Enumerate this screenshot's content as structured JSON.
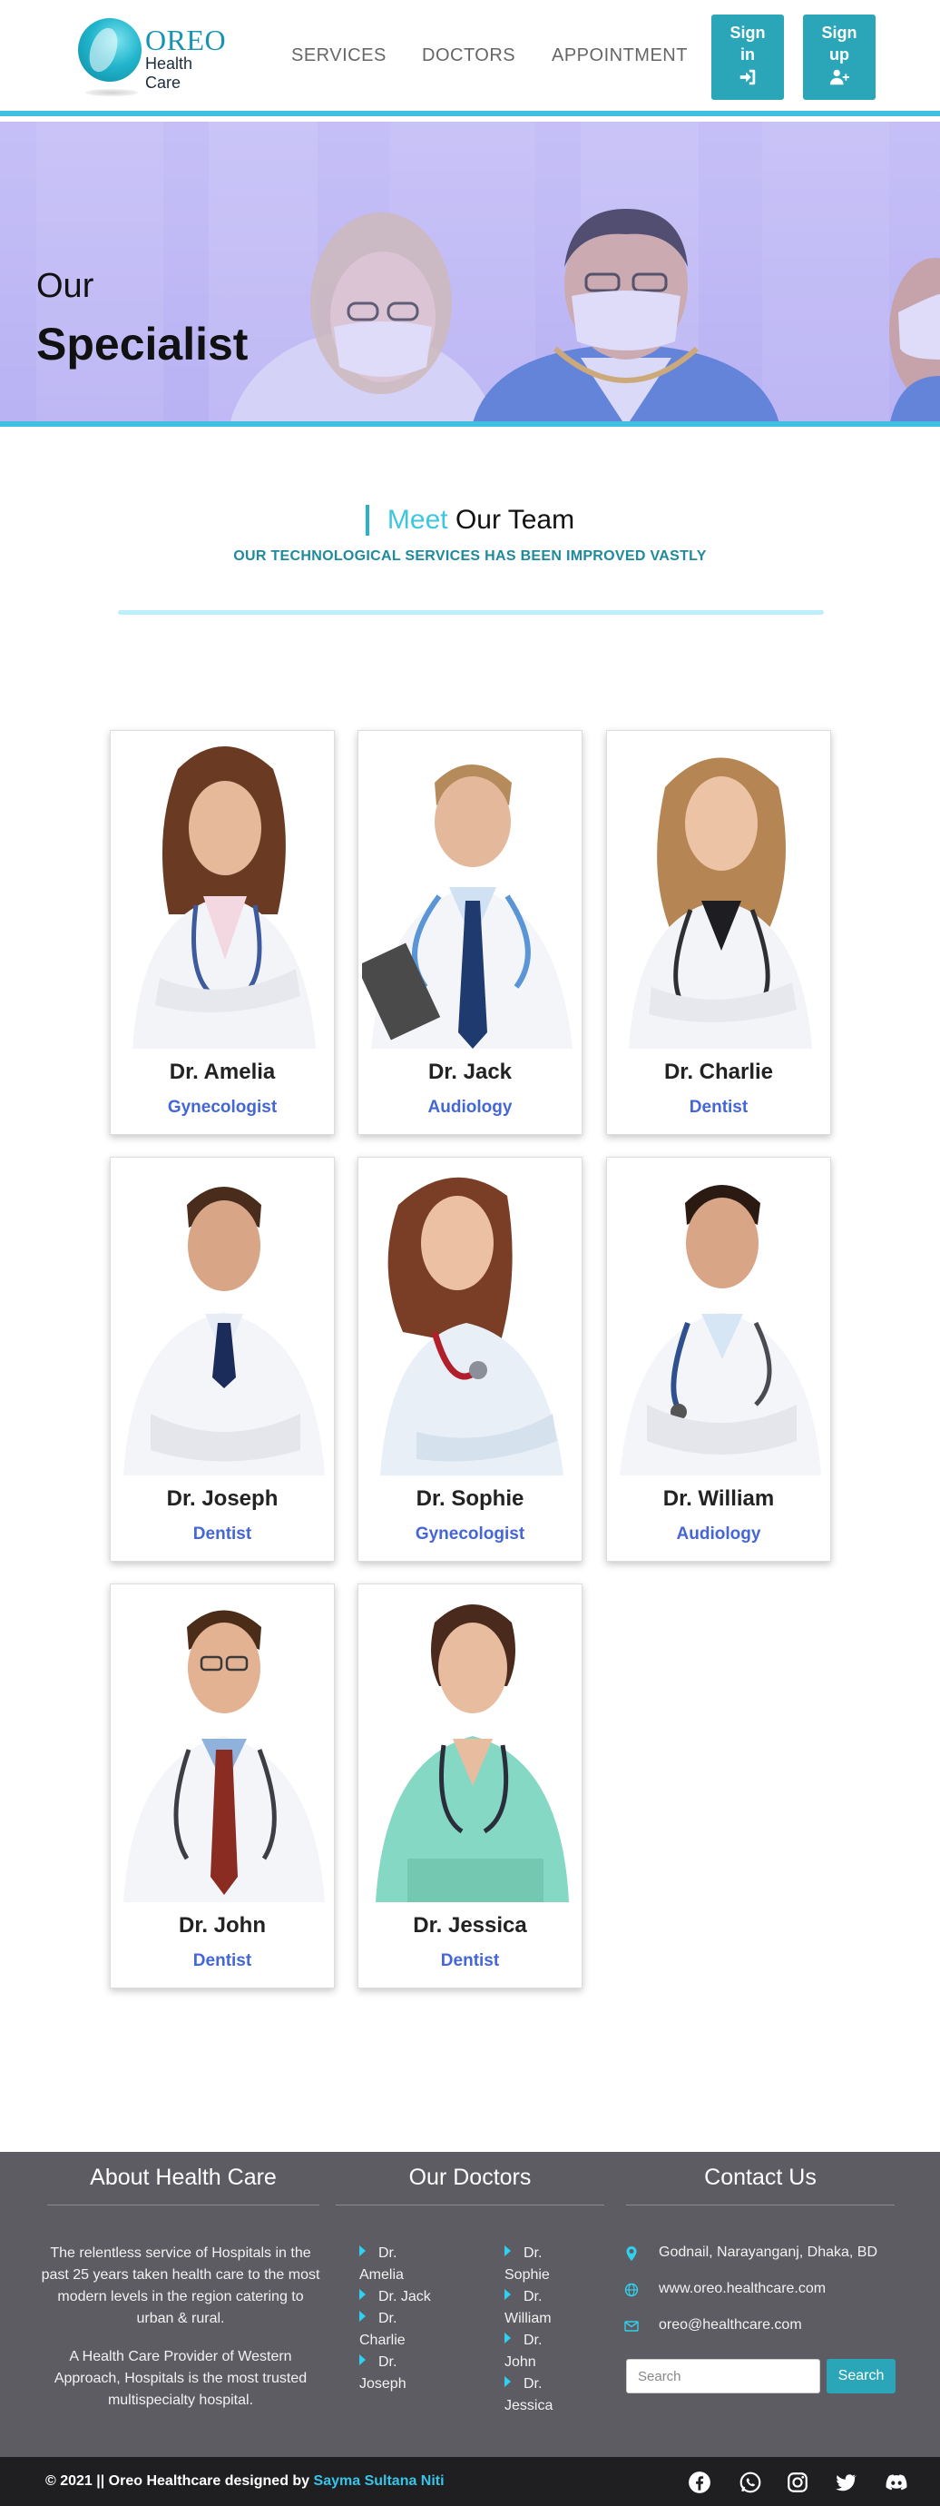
{
  "brand": {
    "name": "OREO",
    "tagline": "Health Care"
  },
  "nav": {
    "services": "SERVICES",
    "doctors": "DOCTORS",
    "appointment": "APPOINTMENT",
    "signin_line1": "Sign",
    "signin_line2": "in",
    "signup_line1": "Sign",
    "signup_line2": "up"
  },
  "hero": {
    "line1": "Our",
    "line2": "Specialist"
  },
  "team": {
    "title_accent": "Meet",
    "title_rest": "Our Team",
    "subtitle": "OUR TECHNOLOGICAL SERVICES HAS BEEN IMPROVED VASTLY"
  },
  "doctors": [
    {
      "name": "Dr. Amelia",
      "specialty": "Gynecologist"
    },
    {
      "name": "Dr. Jack",
      "specialty": "Audiology"
    },
    {
      "name": "Dr. Charlie",
      "specialty": "Dentist"
    },
    {
      "name": "Dr. Joseph",
      "specialty": "Dentist"
    },
    {
      "name": "Dr. Sophie",
      "specialty": "Gynecologist"
    },
    {
      "name": "Dr. William",
      "specialty": "Audiology"
    },
    {
      "name": "Dr. John",
      "specialty": "Dentist"
    },
    {
      "name": "Dr. Jessica",
      "specialty": "Dentist"
    }
  ],
  "footer": {
    "about_title": "About Health Care",
    "about_p1": "The relentless service of Hospitals in the past 25 years taken health care to the most modern levels in the region catering to urban & rural.",
    "about_p2": "A Health Care Provider of Western Approach, Hospitals is the most trusted multispecialty hospital.",
    "doctors_title": "Our Doctors",
    "doctor_links_col1": [
      {
        "line1": "Dr.",
        "line2": "Amelia"
      },
      {
        "line1": "Dr. Jack",
        "line2": ""
      },
      {
        "line1": "Dr.",
        "line2": "Charlie"
      },
      {
        "line1": "Dr.",
        "line2": "Joseph"
      }
    ],
    "doctor_links_col2": [
      {
        "line1": "Dr.",
        "line2": "Sophie"
      },
      {
        "line1": "Dr.",
        "line2": "William"
      },
      {
        "line1": "Dr.",
        "line2": "John"
      },
      {
        "line1": "Dr.",
        "line2": "Jessica"
      }
    ],
    "contact_title": "Contact Us",
    "address": "Godnail, Narayanganj, Dhaka, BD",
    "website": "www.oreo.healthcare.com",
    "email": "oreo@healthcare.com",
    "search_placeholder": "Search",
    "search_button": "Search"
  },
  "bottom": {
    "copyright": "© 2021 || Oreo Healthcare designed by",
    "author": "Sayma Sultana Niti"
  },
  "icons": {
    "signin": "sign-in-icon",
    "signup": "user-plus-icon",
    "address": "map-marker-icon",
    "website": "globe-icon",
    "email": "envelope-icon",
    "social": [
      "facebook-icon",
      "whatsapp-icon",
      "instagram-icon",
      "twitter-icon",
      "discord-icon"
    ]
  },
  "colors": {
    "accent": "#2ba6b9",
    "cyan_line": "#3fc0e0",
    "specialty_blue": "#4466d6",
    "footer_bg": "#5c5c62",
    "bottom_bar": "#1f1f22"
  }
}
